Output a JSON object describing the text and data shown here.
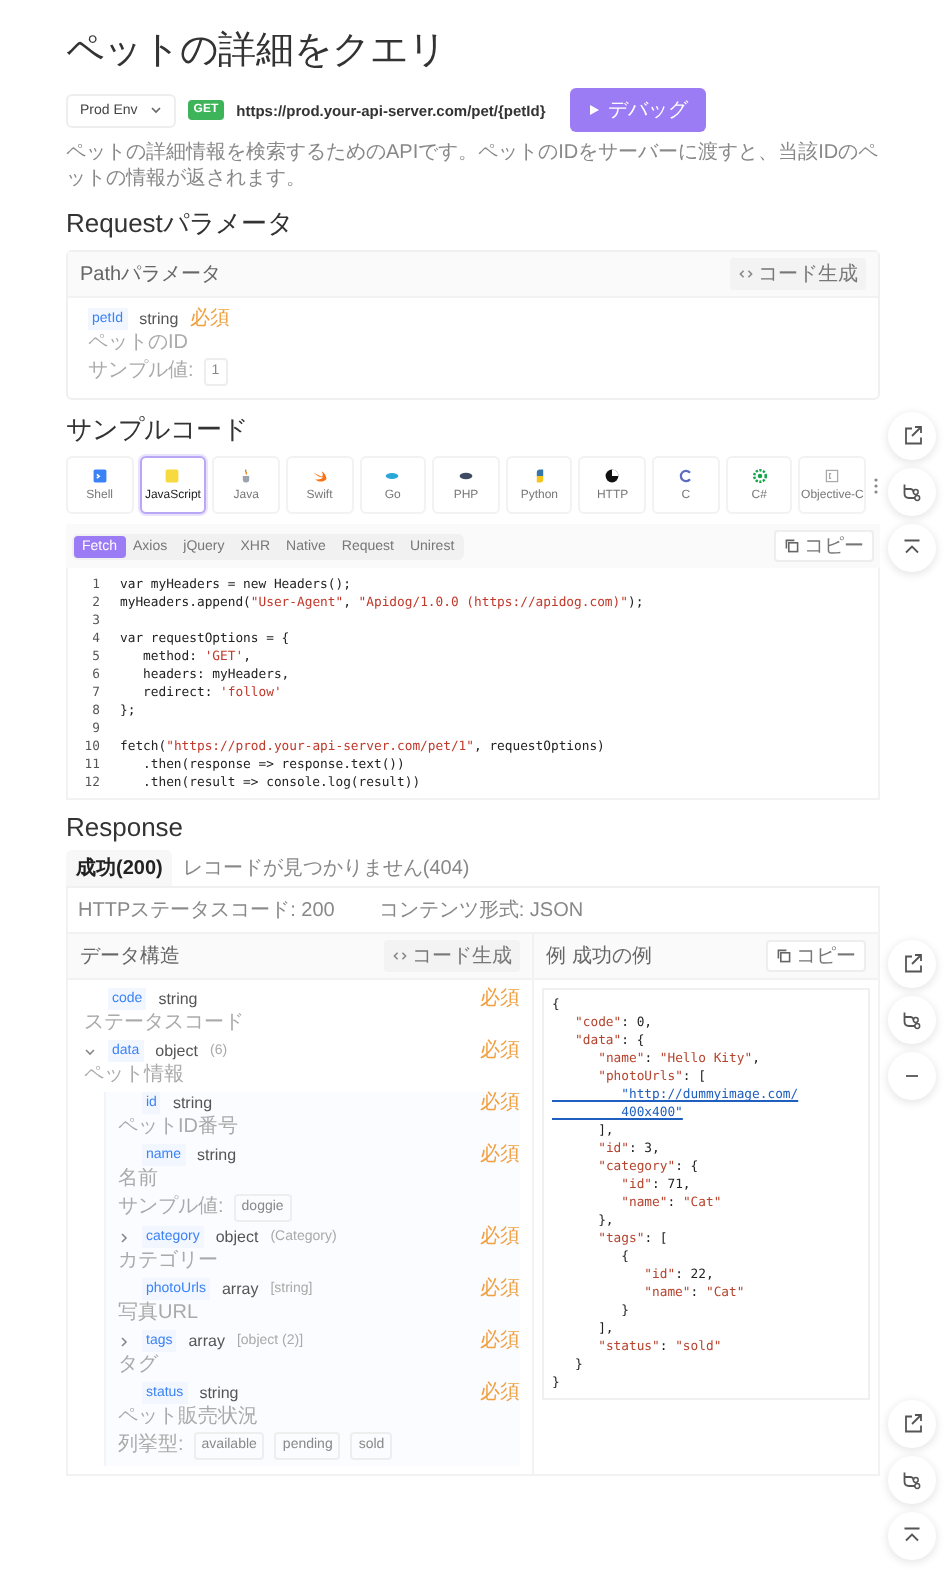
{
  "title": "ペットの詳細をクエリ",
  "endpoint": {
    "environment": "Prod Env",
    "method": "GET",
    "url": "https://prod.your-api-server.com/pet/{petId}",
    "debug_label": "デバッグ"
  },
  "description": "ペットの詳細情報を検索するためのAPIです。ペットのIDをサーバーに渡すと、当該IDのペットの情報が返されます。",
  "request": {
    "heading": "Requestパラメータ",
    "section_title": "Pathパラメータ",
    "code_gen": "コード生成",
    "params": [
      {
        "name": "petId",
        "type": "string",
        "required": "必須",
        "description": "ペットのID",
        "example_label": "サンプル値:",
        "example": "1"
      }
    ]
  },
  "sample_code": {
    "heading": "サンプルコード",
    "languages": [
      {
        "label": "Shell",
        "selected": false
      },
      {
        "label": "JavaScript",
        "selected": true
      },
      {
        "label": "Java",
        "selected": false
      },
      {
        "label": "Swift",
        "selected": false
      },
      {
        "label": "Go",
        "selected": false
      },
      {
        "label": "PHP",
        "selected": false
      },
      {
        "label": "Python",
        "selected": false
      },
      {
        "label": "HTTP",
        "selected": false
      },
      {
        "label": "C",
        "selected": false
      },
      {
        "label": "C#",
        "selected": false
      },
      {
        "label": "Objective-C",
        "selected": false
      }
    ],
    "libraries": [
      {
        "label": "Fetch",
        "selected": true
      },
      {
        "label": "Axios",
        "selected": false
      },
      {
        "label": "jQuery",
        "selected": false
      },
      {
        "label": "XHR",
        "selected": false
      },
      {
        "label": "Native",
        "selected": false
      },
      {
        "label": "Request",
        "selected": false
      },
      {
        "label": "Unirest",
        "selected": false
      }
    ],
    "copy": "コピー",
    "lines": [
      {
        "number": "1",
        "code": "var myHeaders = new Headers();"
      },
      {
        "number": "2",
        "code": "myHeaders.append(\"User-Agent\", \"Apidog/1.0.0 (https://apidog.com)\");"
      },
      {
        "number": "3"
      },
      {
        "number": "4",
        "code": "var requestOptions = {"
      },
      {
        "number": "5",
        "code": "   method: 'GET',"
      },
      {
        "number": "6",
        "code": "   headers: myHeaders,"
      },
      {
        "number": "7",
        "code": "   redirect: 'follow'"
      },
      {
        "number": "8",
        "code": "};"
      },
      {
        "number": "9"
      },
      {
        "number": "10",
        "code": "fetch(\"https://prod.your-api-server.com/pet/1\", requestOptions)"
      },
      {
        "number": "11",
        "code": "   .then(response => response.text())"
      },
      {
        "number": "12",
        "code": "   .then(result => console.log(result))"
      }
    ]
  },
  "response": {
    "heading": "Response",
    "tabs": [
      {
        "label": "成功(200)",
        "selected": true
      },
      {
        "label": "レコードが見つかりません(404)",
        "selected": false
      }
    ],
    "status_code": "HTTPステータスコード: 200",
    "content_type": "コンテンツ形式: JSON",
    "schema": {
      "title": "データ構造",
      "code_gen": "コード生成",
      "fields": [
        {
          "kind": "leaf",
          "name": "code",
          "type": "string",
          "required": "必須",
          "description": "ステータスコード"
        },
        {
          "kind": "group",
          "expanded": true,
          "name": "data",
          "type": "object",
          "type_detail": "(6)",
          "required": "必須",
          "description": "ペット情報",
          "children": [
            {
              "kind": "leaf",
              "name": "id",
              "type": "string",
              "required": "必須",
              "description": "ペットID番号"
            },
            {
              "kind": "leaf",
              "name": "name",
              "type": "string",
              "required": "必須",
              "description": "名前",
              "example_label": "サンプル値:",
              "example": "doggie"
            },
            {
              "kind": "group",
              "expanded": false,
              "name": "category",
              "type": "object",
              "type_detail": "(Category)",
              "required": "必須",
              "description": "カテゴリー"
            },
            {
              "kind": "leaf",
              "name": "photoUrls",
              "type": "array",
              "type_detail": "[string]",
              "required": "必須",
              "description": "写真URL"
            },
            {
              "kind": "group",
              "expanded": false,
              "name": "tags",
              "type": "array",
              "type_detail": "[object (2)]",
              "required": "必須",
              "description": "タグ"
            },
            {
              "kind": "leaf",
              "name": "status",
              "type": "string",
              "required": "必須",
              "description": "ペット販売状況",
              "enum_label": "列挙型:",
              "enum": [
                "available",
                "pending",
                "sold"
              ]
            }
          ]
        }
      ]
    },
    "example": {
      "title": "例 成功の例",
      "copy": "コピー",
      "lines": [
        {
          "kind": "code",
          "code": "{"
        },
        {
          "kind": "code",
          "code": "   \"code\": 0,"
        },
        {
          "kind": "code",
          "code": "   \"data\": {"
        },
        {
          "kind": "code",
          "code": "      \"name\": \"Hello Kity\","
        },
        {
          "kind": "code",
          "code": "      \"photoUrls\": ["
        },
        {
          "kind": "link",
          "code": "         \"http://dummyimage.com/"
        },
        {
          "kind": "link",
          "code": "         400x400\""
        },
        {
          "kind": "code",
          "code": "      ],"
        },
        {
          "kind": "code",
          "code": "      \"id\": 3,"
        },
        {
          "kind": "code",
          "code": "      \"category\": {"
        },
        {
          "kind": "code",
          "code": "         \"id\": 71,"
        },
        {
          "kind": "code",
          "code": "         \"name\": \"Cat\""
        },
        {
          "kind": "code",
          "code": "      },"
        },
        {
          "kind": "code",
          "code": "      \"tags\": ["
        },
        {
          "kind": "code",
          "code": "         {"
        },
        {
          "kind": "code",
          "code": "            \"id\": 22,"
        },
        {
          "kind": "code",
          "code": "            \"name\": \"Cat\""
        },
        {
          "kind": "code",
          "code": "         }"
        },
        {
          "kind": "code",
          "code": "      ],"
        },
        {
          "kind": "code",
          "code": "      \"status\": \"sold\""
        },
        {
          "kind": "code",
          "code": "   }"
        },
        {
          "kind": "code",
          "code": "}"
        }
      ]
    }
  }
}
